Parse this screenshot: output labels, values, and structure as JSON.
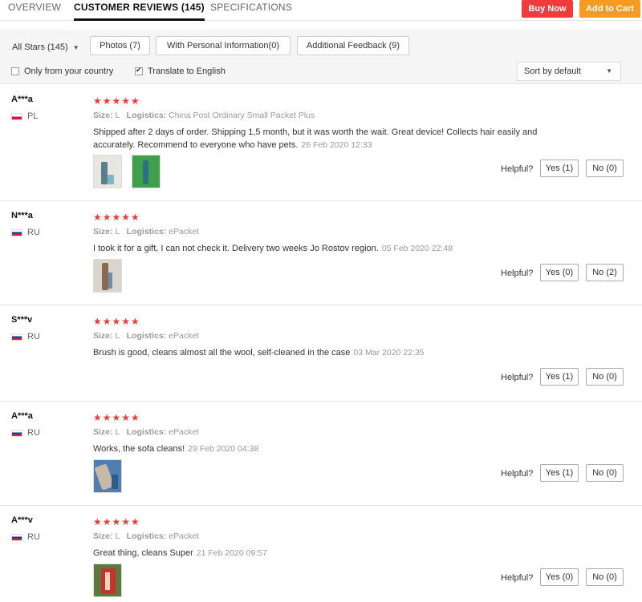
{
  "tabs": [
    {
      "label": "OVERVIEW"
    },
    {
      "label": "CUSTOMER REVIEWS (145)"
    },
    {
      "label": "SPECIFICATIONS"
    }
  ],
  "actions": {
    "buy_now": "Buy Now",
    "add_to_cart": "Add to Cart"
  },
  "filters": {
    "all_stars": "All Stars (145)",
    "photos": "Photos (7)",
    "personal_info": "With Personal Information(0)",
    "additional_feedback": "Additional Feedback (9)",
    "only_country": "Only from your country",
    "translate": "Translate to English",
    "sort": "Sort by default"
  },
  "labels": {
    "size": "Size:",
    "logistics": "Logistics:",
    "helpful": "Helpful?"
  },
  "colors": {
    "accent_red": "#ef3b3b",
    "accent_orange": "#f59a23",
    "stars": "#e93b3b"
  },
  "reviews": [
    {
      "user": "A***a",
      "country": "PL",
      "stars": "★★★★★",
      "size": "L",
      "logistics": "China Post Ordinary Small Packet Plus",
      "text": "Shipped after 2 days of order. Shipping 1,5 month, but it was worth the wait. Great device! Collects hair easily and accurately. Recommend to everyone who have pets.",
      "date": "26 Feb 2020 12:33",
      "yes": "Yes (1)",
      "no": "No (0)"
    },
    {
      "user": "N***a",
      "country": "RU",
      "stars": "★★★★★",
      "size": "L",
      "logistics": "ePacket",
      "text": "I took it for a gift, I can not check it. Delivery two weeks Jo Rostov region.",
      "date": "05 Feb 2020 22:48",
      "yes": "Yes (0)",
      "no": "No (2)"
    },
    {
      "user": "S***v",
      "country": "RU",
      "stars": "★★★★★",
      "size": "L",
      "logistics": "ePacket",
      "text": "Brush is good, cleans almost all the wool, self-cleaned in the case",
      "date": "03 Mar 2020 22:35",
      "yes": "Yes (1)",
      "no": "No (0)"
    },
    {
      "user": "A***a",
      "country": "RU",
      "stars": "★★★★★",
      "size": "L",
      "logistics": "ePacket",
      "text": "Works, the sofa cleans!",
      "date": "29 Feb 2020 04:38",
      "yes": "Yes (1)",
      "no": "No (0)"
    },
    {
      "user": "A***v",
      "country": "RU",
      "stars": "★★★★★",
      "size": "L",
      "logistics": "ePacket",
      "text": "Great thing, cleans Super",
      "date": "21 Feb 2020 09:57",
      "yes": "Yes (0)",
      "no": "No (0)"
    }
  ]
}
